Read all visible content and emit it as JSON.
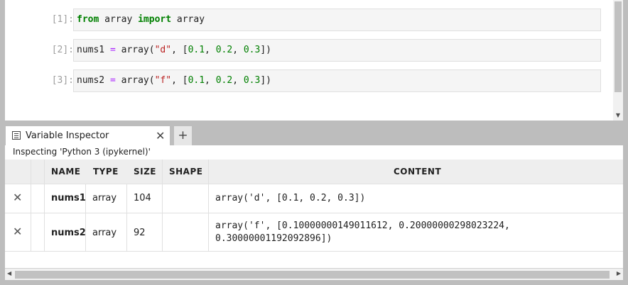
{
  "notebook": {
    "cells": [
      {
        "prompt": "[1]:",
        "tokens": [
          [
            "kw",
            "from"
          ],
          [
            "t",
            " array "
          ],
          [
            "kw",
            "import"
          ],
          [
            "t",
            " array"
          ]
        ]
      },
      {
        "prompt": "[2]:",
        "tokens": [
          [
            "t",
            "nums1 "
          ],
          [
            "op",
            "="
          ],
          [
            "t",
            " array("
          ],
          [
            "str",
            "\"d\""
          ],
          [
            "t",
            ", ["
          ],
          [
            "num",
            "0.1"
          ],
          [
            "t",
            ", "
          ],
          [
            "num",
            "0.2"
          ],
          [
            "t",
            ", "
          ],
          [
            "num",
            "0.3"
          ],
          [
            "t",
            "])"
          ]
        ]
      },
      {
        "prompt": "[3]:",
        "tokens": [
          [
            "t",
            "nums2 "
          ],
          [
            "op",
            "="
          ],
          [
            "t",
            " array("
          ],
          [
            "str",
            "\"f\""
          ],
          [
            "t",
            ", ["
          ],
          [
            "num",
            "0.1"
          ],
          [
            "t",
            ", "
          ],
          [
            "num",
            "0.2"
          ],
          [
            "t",
            ", "
          ],
          [
            "num",
            "0.3"
          ],
          [
            "t",
            "])"
          ]
        ]
      }
    ]
  },
  "inspector": {
    "tab_label": "Variable Inspector",
    "close_glyph": "✕",
    "add_glyph": "+",
    "inspecting": "Inspecting 'Python 3 (ipykernel)'",
    "columns": {
      "name": "NAME",
      "type": "TYPE",
      "size": "SIZE",
      "shape": "SHAPE",
      "content": "CONTENT"
    },
    "delete_glyph": "✕",
    "rows": [
      {
        "name": "nums1",
        "type": "array",
        "size": "104",
        "shape": "",
        "content_lines": [
          "array('d', [0.1, 0.2, 0.3])"
        ]
      },
      {
        "name": "nums2",
        "type": "array",
        "size": "92",
        "shape": "",
        "content_lines": [
          "array('f', [0.10000000149011612, 0.20000000298023224,",
          "0.30000001192092896])"
        ]
      }
    ]
  },
  "scrollbar_arrows": {
    "left": "◀",
    "right": "▶",
    "down": "▼"
  }
}
